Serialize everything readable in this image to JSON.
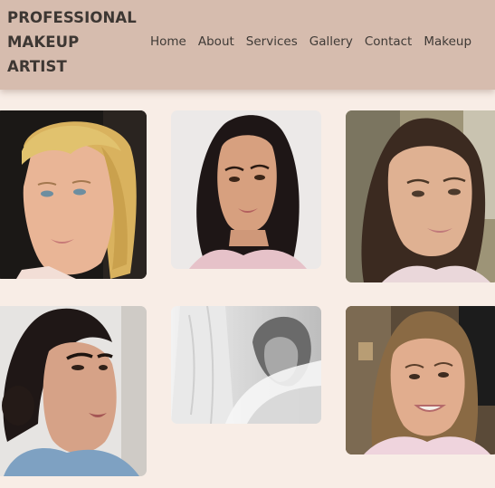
{
  "brand": {
    "line1": "PROFESSIONAL",
    "line2": "MAKEUP",
    "line3": "ARTIST"
  },
  "nav": {
    "items": [
      {
        "label": "Home"
      },
      {
        "label": "About"
      },
      {
        "label": "Services"
      },
      {
        "label": "Gallery"
      },
      {
        "label": "Contact"
      },
      {
        "label": "Makeup"
      }
    ]
  },
  "gallery": {
    "photos": [
      {
        "subject": "blonde woman in profile with soft glam makeup"
      },
      {
        "subject": "dark wavy hair woman with bronze glam makeup"
      },
      {
        "subject": "brunette woman with natural glam makeup"
      },
      {
        "subject": "dark hair updo woman with bold brows in profile"
      },
      {
        "subject": "black and white bride with veil"
      },
      {
        "subject": "smiling woman with soft waves"
      }
    ]
  },
  "colors": {
    "header_bg": "#d6bcae",
    "page_bg": "#f8ede6",
    "text": "#3d3733"
  }
}
